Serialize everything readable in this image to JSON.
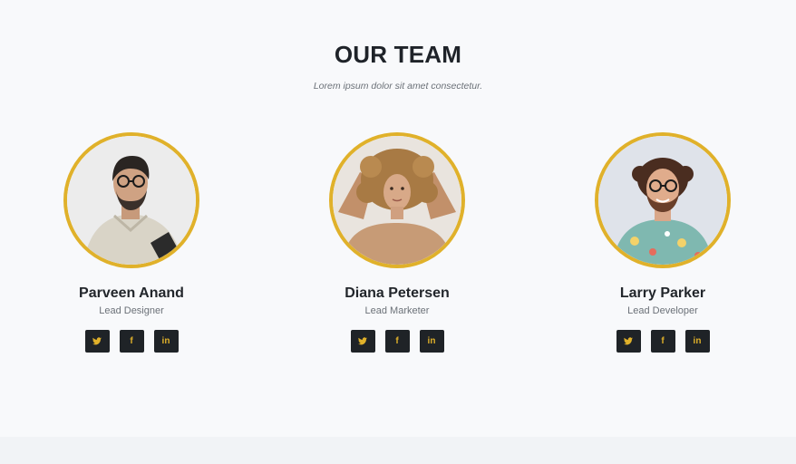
{
  "section": {
    "title": "OUR TEAM",
    "subtitle": "Lorem ipsum dolor sit amet consectetur."
  },
  "team": [
    {
      "name": "Parveen Anand",
      "role": "Lead Designer"
    },
    {
      "name": "Diana Petersen",
      "role": "Lead Marketer"
    },
    {
      "name": "Larry Parker",
      "role": "Lead Developer"
    }
  ],
  "socials": [
    {
      "icon": "twitter-icon"
    },
    {
      "icon": "facebook-icon",
      "glyph": "f"
    },
    {
      "icon": "linkedin-icon",
      "glyph": "in"
    }
  ],
  "colors": {
    "accent": "#e0b12a",
    "button_bg": "#1f2327",
    "heading": "#1f2329",
    "muted": "#6b7178"
  }
}
